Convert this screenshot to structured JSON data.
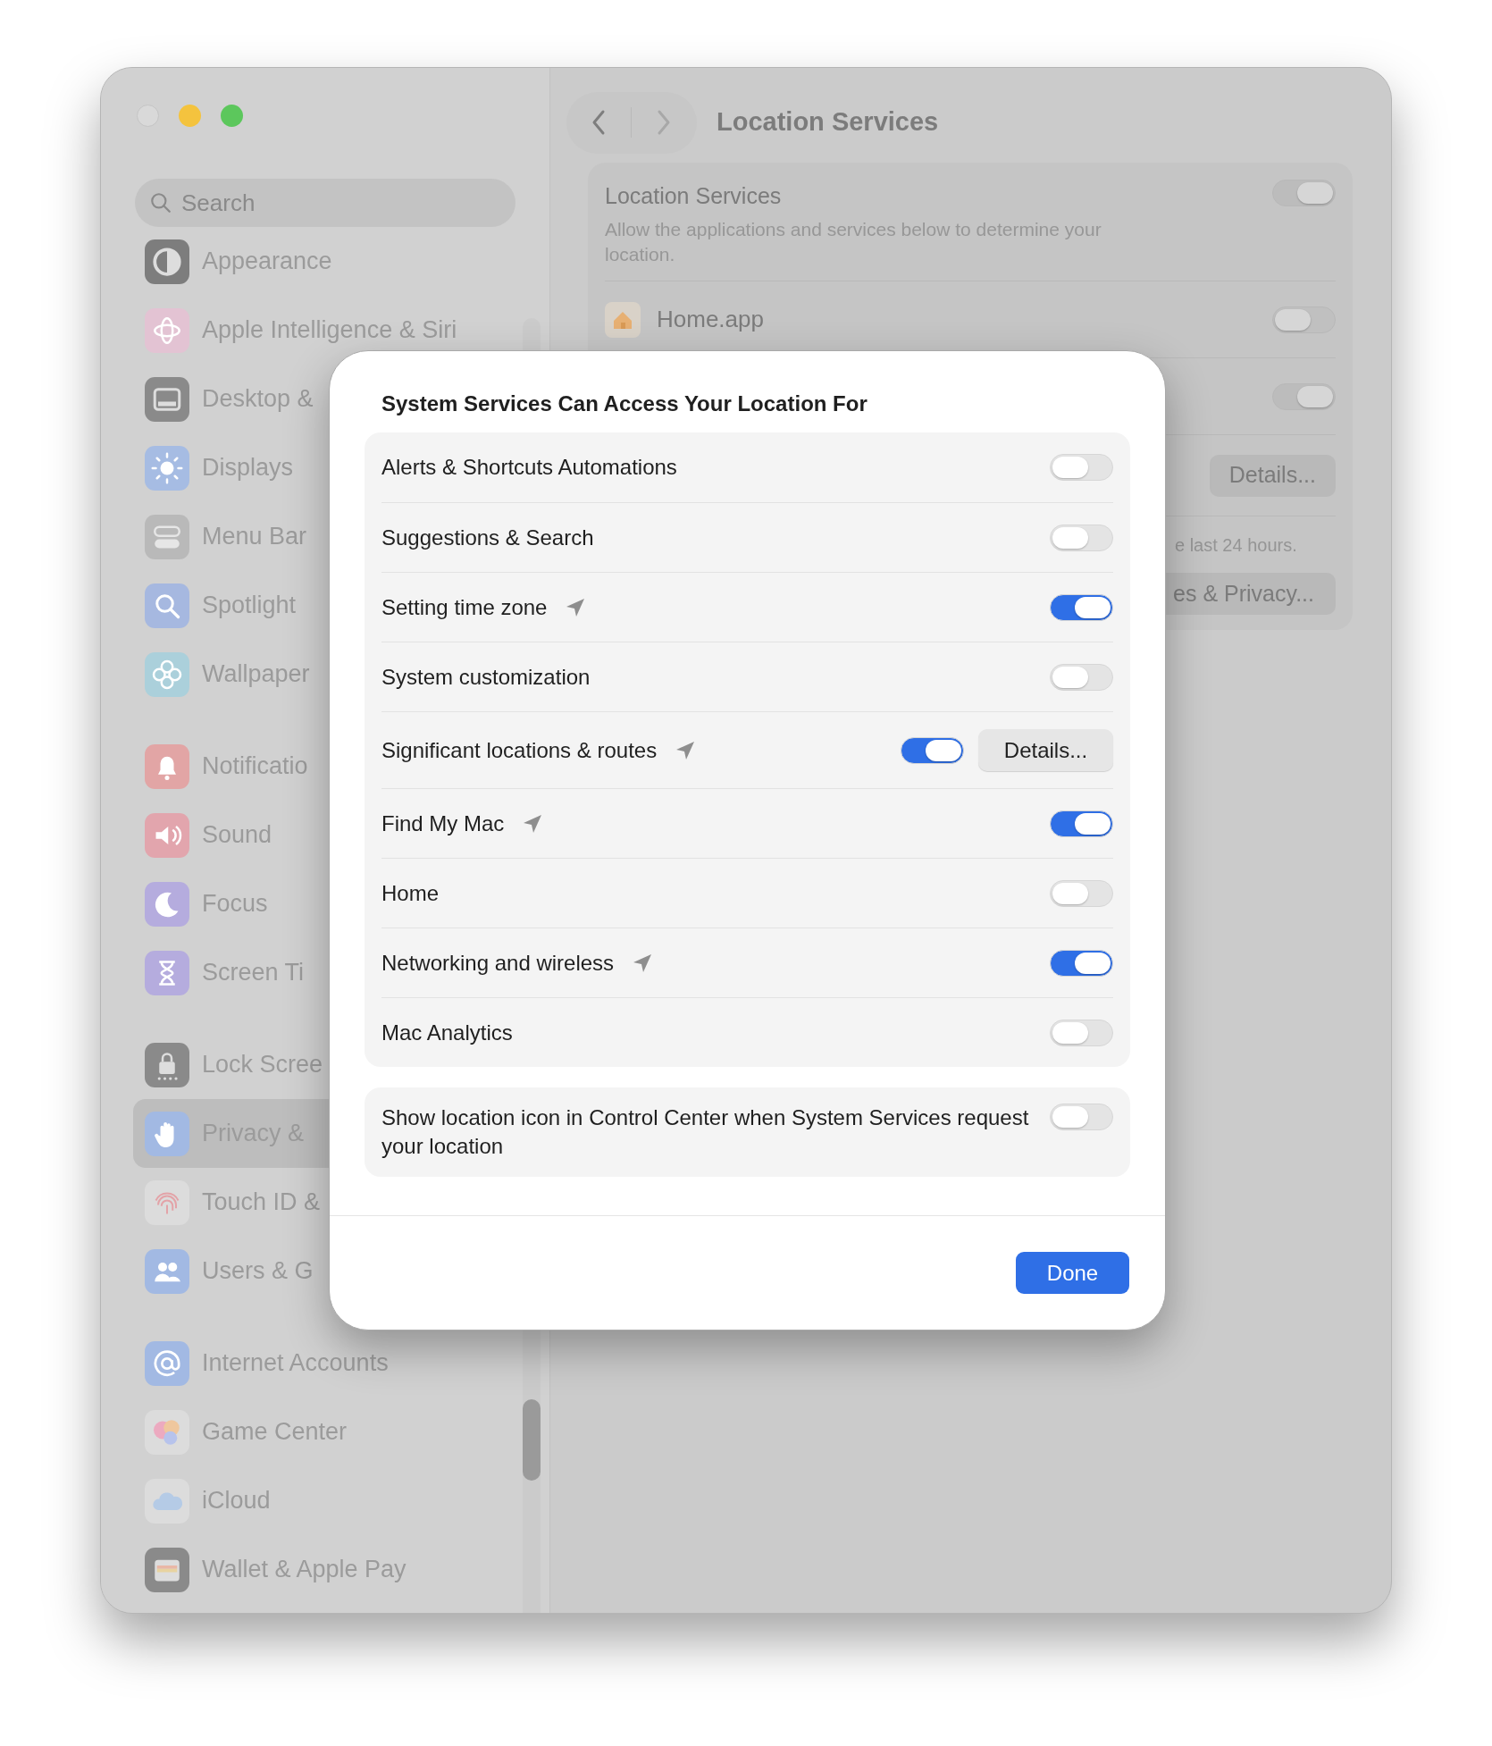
{
  "window": {
    "title": "Location Services"
  },
  "sidebar": {
    "search": {
      "placeholder": "Search"
    },
    "groups": [
      {
        "items": [
          {
            "label": "Appearance",
            "selected": false
          },
          {
            "label": "Apple Intelligence & Siri",
            "selected": false
          },
          {
            "label": "Desktop &",
            "selected": false
          },
          {
            "label": "Displays",
            "selected": false
          },
          {
            "label": "Menu Bar",
            "selected": false
          },
          {
            "label": "Spotlight",
            "selected": false
          },
          {
            "label": "Wallpaper",
            "selected": false
          }
        ]
      },
      {
        "items": [
          {
            "label": "Notificatio",
            "selected": false
          },
          {
            "label": "Sound",
            "selected": false
          },
          {
            "label": "Focus",
            "selected": false
          },
          {
            "label": "Screen Ti",
            "selected": false
          }
        ]
      },
      {
        "items": [
          {
            "label": "Lock Scree",
            "selected": false
          },
          {
            "label": "Privacy &",
            "selected": true
          },
          {
            "label": "Touch ID &",
            "selected": false
          },
          {
            "label": "Users & G",
            "selected": false
          }
        ]
      },
      {
        "items": [
          {
            "label": "Internet Accounts",
            "selected": false
          },
          {
            "label": "Game Center",
            "selected": false
          },
          {
            "label": "iCloud",
            "selected": false
          },
          {
            "label": "Wallet & Apple Pay",
            "selected": false
          }
        ]
      }
    ]
  },
  "main": {
    "location_services": {
      "title": "Location Services",
      "description": "Allow the applications and services below to determine your location.",
      "on": true
    },
    "rows": [
      {
        "kind": "app",
        "name": "Home.app",
        "on": false
      },
      {
        "kind": "toggle",
        "on": true
      },
      {
        "kind": "button",
        "button": "Details..."
      },
      {
        "kind": "note",
        "text": "e last 24 hours."
      },
      {
        "kind": "button",
        "button": "es & Privacy..."
      }
    ]
  },
  "dialog": {
    "title": "System Services Can Access Your Location For",
    "services": [
      {
        "label": "Alerts & Shortcuts Automations",
        "location_used": false,
        "on": false
      },
      {
        "label": "Suggestions & Search",
        "location_used": false,
        "on": false
      },
      {
        "label": "Setting time zone",
        "location_used": true,
        "on": true
      },
      {
        "label": "System customization",
        "location_used": false,
        "on": false
      },
      {
        "label": "Significant locations & routes",
        "location_used": true,
        "on": true,
        "button": "Details..."
      },
      {
        "label": "Find My Mac",
        "location_used": true,
        "on": true
      },
      {
        "label": "Home",
        "location_used": false,
        "on": false
      },
      {
        "label": "Networking and wireless",
        "location_used": true,
        "on": true
      },
      {
        "label": "Mac Analytics",
        "location_used": false,
        "on": false
      }
    ],
    "indicator": {
      "label": "Show location icon in Control Center when System Services request your location",
      "on": false
    },
    "done": "Done"
  }
}
